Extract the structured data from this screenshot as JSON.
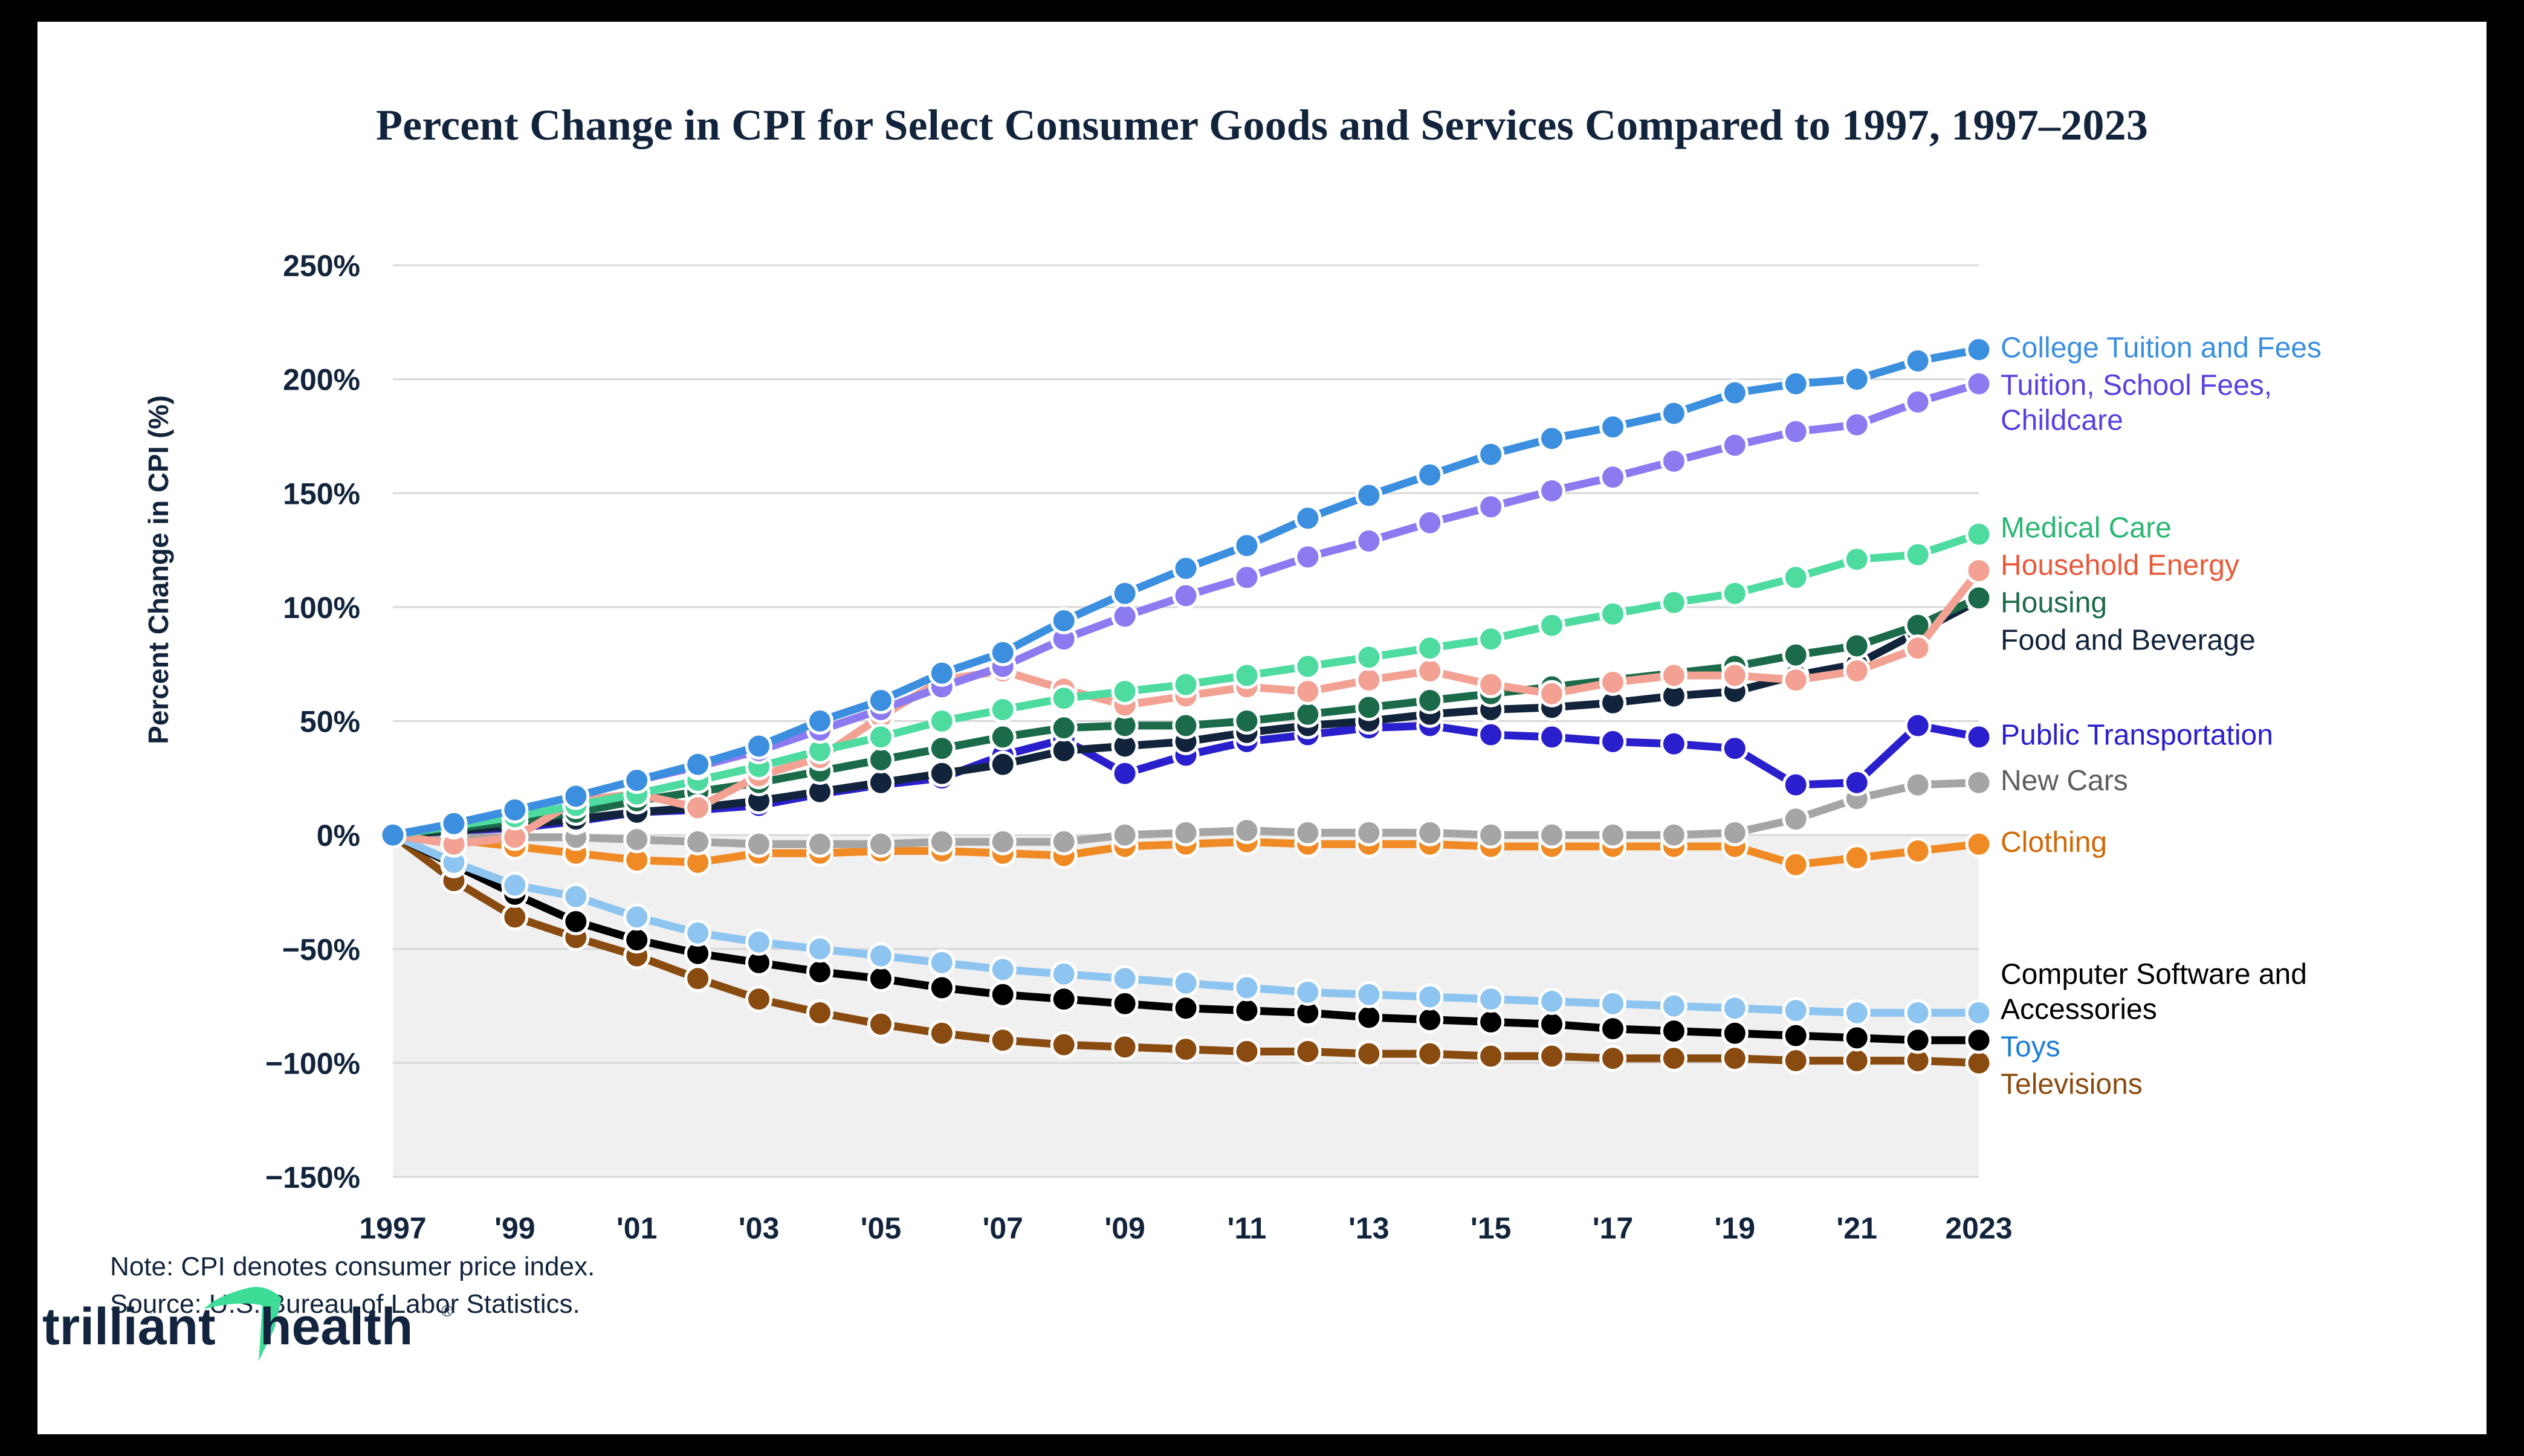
{
  "title": "Percent Change in CPI for Select Consumer Goods and Services Compared to 1997, 1997–2023",
  "axis": {
    "ylabel": "Percent Change in CPI (%)"
  },
  "note": {
    "line1": "Note: CPI denotes consumer price index.",
    "line2": "Source: U.S. Bureau of Labor Statistics."
  },
  "logo": {
    "word1": "trilliant",
    "word2": "health",
    "registered": "®",
    "accent": "#3ddc97",
    "ink": "#13243e"
  },
  "chart_data": {
    "type": "line",
    "title": "Percent Change in CPI for Select Consumer Goods and Services Compared to 1997, 1997–2023",
    "xlabel": "",
    "ylabel": "Percent Change in CPI (%)",
    "ylim": [
      -150,
      250
    ],
    "yticks": [
      250,
      200,
      150,
      100,
      50,
      0,
      -50,
      -100,
      -150
    ],
    "ytick_labels": [
      "250%",
      "200%",
      "150%",
      "100%",
      "50%",
      "0%",
      "−50%",
      "−100%",
      "−150%"
    ],
    "grid": true,
    "legend_position": "right",
    "x": [
      1997,
      1998,
      1999,
      2000,
      2001,
      2002,
      2003,
      2004,
      2005,
      2006,
      2007,
      2008,
      2009,
      2010,
      2011,
      2012,
      2013,
      2014,
      2015,
      2016,
      2017,
      2018,
      2019,
      2020,
      2021,
      2022,
      2023
    ],
    "xtick_years": [
      1997,
      1999,
      2001,
      2003,
      2005,
      2007,
      2009,
      2011,
      2013,
      2015,
      2017,
      2019,
      2021,
      2023
    ],
    "xtick_labels": [
      "1997",
      "'99",
      "'01",
      "'03",
      "'05",
      "'07",
      "'09",
      "'11",
      "'13",
      "'15",
      "'17",
      "'19",
      "'21",
      "2023"
    ],
    "series": [
      {
        "name": "College Tuition and Fees",
        "color": "#3b8fde",
        "values": [
          0,
          5,
          11,
          17,
          24,
          31,
          39,
          50,
          59,
          71,
          80,
          94,
          106,
          117,
          127,
          139,
          149,
          158,
          167,
          174,
          179,
          185,
          194,
          198,
          200,
          208,
          213
        ]
      },
      {
        "name": "Tuition, School Fees, Childcare",
        "color": "#8b7af0",
        "values": [
          0,
          5,
          11,
          17,
          24,
          30,
          37,
          46,
          55,
          65,
          74,
          86,
          96,
          105,
          113,
          122,
          129,
          137,
          144,
          151,
          157,
          164,
          171,
          177,
          180,
          190,
          198
        ]
      },
      {
        "name": "Medical Care",
        "color": "#4ddba0",
        "values": [
          0,
          4,
          8,
          13,
          18,
          24,
          30,
          37,
          43,
          50,
          55,
          60,
          63,
          66,
          70,
          74,
          78,
          82,
          86,
          92,
          97,
          102,
          106,
          113,
          121,
          123,
          132,
          134
        ]
      },
      {
        "name": "Household Energy",
        "color": "#f2a193",
        "values": [
          0,
          -4,
          -1,
          15,
          18,
          12,
          26,
          34,
          52,
          68,
          72,
          64,
          57,
          61,
          65,
          63,
          68,
          72,
          66,
          62,
          67,
          70,
          70,
          68,
          72,
          82,
          116,
          119
        ]
      },
      {
        "name": "Housing",
        "color": "#1b6b4a",
        "values": [
          0,
          3,
          6,
          10,
          15,
          19,
          23,
          28,
          33,
          38,
          43,
          47,
          48,
          48,
          50,
          53,
          56,
          59,
          62,
          65,
          68,
          71,
          74,
          79,
          83,
          92,
          104
        ]
      },
      {
        "name": "Food and Beverage",
        "color": "#12243c",
        "values": [
          0,
          2,
          4,
          7,
          10,
          12,
          15,
          19,
          23,
          27,
          31,
          37,
          39,
          41,
          45,
          48,
          50,
          53,
          55,
          56,
          58,
          61,
          63,
          70,
          75,
          89,
          103
        ]
      },
      {
        "name": "Public Transportation",
        "color": "#2a1fcc",
        "values": [
          0,
          2,
          3,
          6,
          10,
          11,
          13,
          18,
          22,
          25,
          35,
          42,
          27,
          35,
          41,
          44,
          47,
          48,
          44,
          43,
          41,
          40,
          38,
          22,
          23,
          48,
          43
        ]
      },
      {
        "name": "New Cars",
        "color": "#a5a5a5",
        "values": [
          0,
          -1,
          -1,
          -1,
          -2,
          -3,
          -4,
          -4,
          -4,
          -3,
          -3,
          -3,
          0,
          1,
          2,
          1,
          1,
          1,
          0,
          0,
          0,
          0,
          1,
          7,
          16,
          22,
          23
        ]
      },
      {
        "name": "Clothing",
        "color": "#f08a24",
        "values": [
          0,
          -2,
          -5,
          -8,
          -11,
          -12,
          -8,
          -8,
          -7,
          -7,
          -8,
          -9,
          -5,
          -4,
          -3,
          -4,
          -4,
          -4,
          -5,
          -5,
          -5,
          -5,
          -5,
          -13,
          -10,
          -7,
          -4
        ]
      },
      {
        "name": "Computer Software and Accessories",
        "color": "#000000",
        "values": [
          0,
          -13,
          -26,
          -38,
          -46,
          -52,
          -56,
          -60,
          -63,
          -67,
          -70,
          -72,
          -74,
          -76,
          -77,
          -78,
          -80,
          -81,
          -82,
          -83,
          -85,
          -86,
          -87,
          -88,
          -89,
          -90,
          -90
        ]
      },
      {
        "name": "Toys",
        "color": "#8ec5f0",
        "values": [
          0,
          -12,
          -22,
          -27,
          -36,
          -43,
          -47,
          -50,
          -53,
          -56,
          -59,
          -61,
          -63,
          -65,
          -67,
          -69,
          -70,
          -71,
          -72,
          -73,
          -74,
          -75,
          -76,
          -77,
          -78,
          -78,
          -78
        ]
      },
      {
        "name": "Televisions",
        "color": "#8a4b10",
        "values": [
          0,
          -20,
          -36,
          -45,
          -53,
          -63,
          -72,
          -78,
          -83,
          -87,
          -90,
          -92,
          -93,
          -94,
          -95,
          -95,
          -96,
          -96,
          -97,
          -97,
          -98,
          -98,
          -98,
          -99,
          -99,
          -99,
          -100
        ]
      }
    ],
    "legend": [
      {
        "label": "College Tuition and Fees",
        "color": "#3b8fde",
        "y": 213
      },
      {
        "label": "Tuition, School Fees,",
        "label2": "Childcare",
        "color": "#5b3fe0",
        "y": 198
      },
      {
        "label": "Medical Care",
        "color": "#2bb673",
        "y": 134
      },
      {
        "label": "Household Energy",
        "color": "#e8593a",
        "y": 119
      },
      {
        "label": "Housing",
        "color": "#1b6b4a",
        "y": 104
      },
      {
        "label": "Food and Beverage",
        "color": "#12243c",
        "y": 92
      },
      {
        "label": "Public Transportation",
        "color": "#2a1fcc",
        "y": 43
      },
      {
        "label": "New Cars",
        "color": "#5e5e5e",
        "y": 23
      },
      {
        "label": "Clothing",
        "color": "#cf6a09",
        "y": -4
      },
      {
        "label": "Computer Software and",
        "label2": "Accessories",
        "color": "#000000",
        "y": -62
      },
      {
        "label": "Toys",
        "color": "#1f7fd6",
        "y": -78
      },
      {
        "label": "Televisions",
        "color": "#8a4b10",
        "y": -100
      }
    ]
  }
}
